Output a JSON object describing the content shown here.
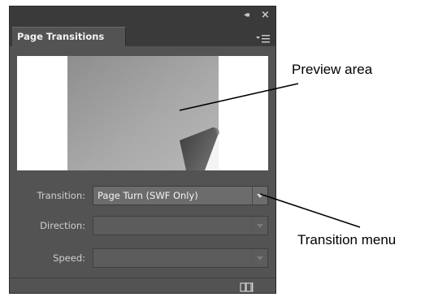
{
  "panel": {
    "title": "Page Transitions",
    "collapse_icon": "double-chevron-left-icon",
    "close_icon": "close-icon",
    "menu_icon": "panel-menu-icon",
    "collapse_glyph": "◂◂",
    "close_glyph": "×"
  },
  "fields": {
    "transition": {
      "label": "Transition:",
      "value": "Page Turn (SWF Only)"
    },
    "direction": {
      "label": "Direction:",
      "value": ""
    },
    "speed": {
      "label": "Speed:",
      "value": ""
    }
  },
  "footer": {
    "button_icon": "apply-to-all-spreads-icon"
  },
  "callouts": {
    "preview": "Preview area",
    "transition_menu": "Transition menu"
  },
  "colors": {
    "panel_bg": "#535353",
    "dark_strip": "#3a3a3a",
    "label_text": "#d0d0d0"
  }
}
